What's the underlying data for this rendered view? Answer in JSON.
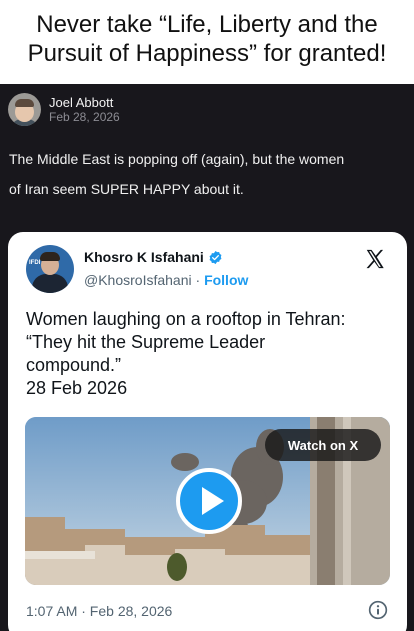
{
  "caption": {
    "line1": "Never take “Life, Liberty and the",
    "line2": "Pursuit of Happiness” for granted!"
  },
  "post": {
    "author_name": "Joel Abbott",
    "date": "Feb 28, 2026",
    "text_line1": "The Middle East is popping off (again), but the women",
    "text_line2": "of Iran seem SUPER HAPPY about it."
  },
  "tweet": {
    "name": "Khosro K Isfahani",
    "handle": "@KhosroIsfahani",
    "separator": "·",
    "follow_label": "Follow",
    "avatar_tag": "IFDI",
    "body_line1": "Women laughing on a rooftop in Tehran:",
    "body_line2": "“They hit the Supreme Leader",
    "body_line3": "compound.”",
    "body_line4": "28 Feb 2026",
    "watch_label": "Watch on X",
    "timestamp": "1:07 AM · Feb 28, 2026",
    "icons": [
      "verified-badge-icon",
      "x-logo-icon",
      "play-icon",
      "info-icon"
    ]
  },
  "colors": {
    "post_background": "#18171c",
    "accent_blue": "#1d9bf0",
    "tweet_text": "#0f1419",
    "tweet_secondary": "#536471"
  }
}
